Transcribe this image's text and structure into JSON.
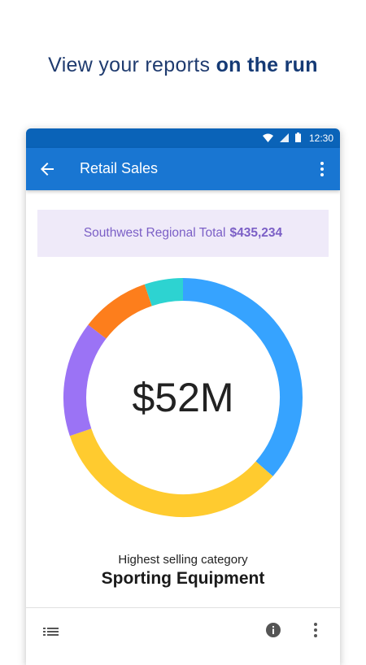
{
  "headline": {
    "prefix": "View your reports ",
    "emphasis": "on the run"
  },
  "status_bar": {
    "time": "12:30"
  },
  "app_bar": {
    "title": "Retail Sales"
  },
  "banner": {
    "label": "Southwest Regional Total",
    "amount": "$435,234",
    "color": "#7b5fc6"
  },
  "chart_data": {
    "type": "pie",
    "center_label": "$52M",
    "segments": [
      {
        "value": 35,
        "color": "#36a3ff"
      },
      {
        "value": 32,
        "color": "#ffcb2f"
      },
      {
        "value": 15,
        "color": "#9b73f5"
      },
      {
        "value": 9,
        "color": "#fd7e1c"
      },
      {
        "value": 5,
        "color": "#2dd3d1"
      }
    ]
  },
  "caption": {
    "subtitle": "Highest selling category",
    "category": "Sporting Equipment"
  },
  "bottom_bar": {
    "icons": [
      "list-icon",
      "info-icon",
      "more-vert-icon"
    ]
  },
  "colors": {
    "status_bar": "#0a63b8",
    "app_bar": "#1976d2",
    "headline": "#1f3b6f"
  }
}
